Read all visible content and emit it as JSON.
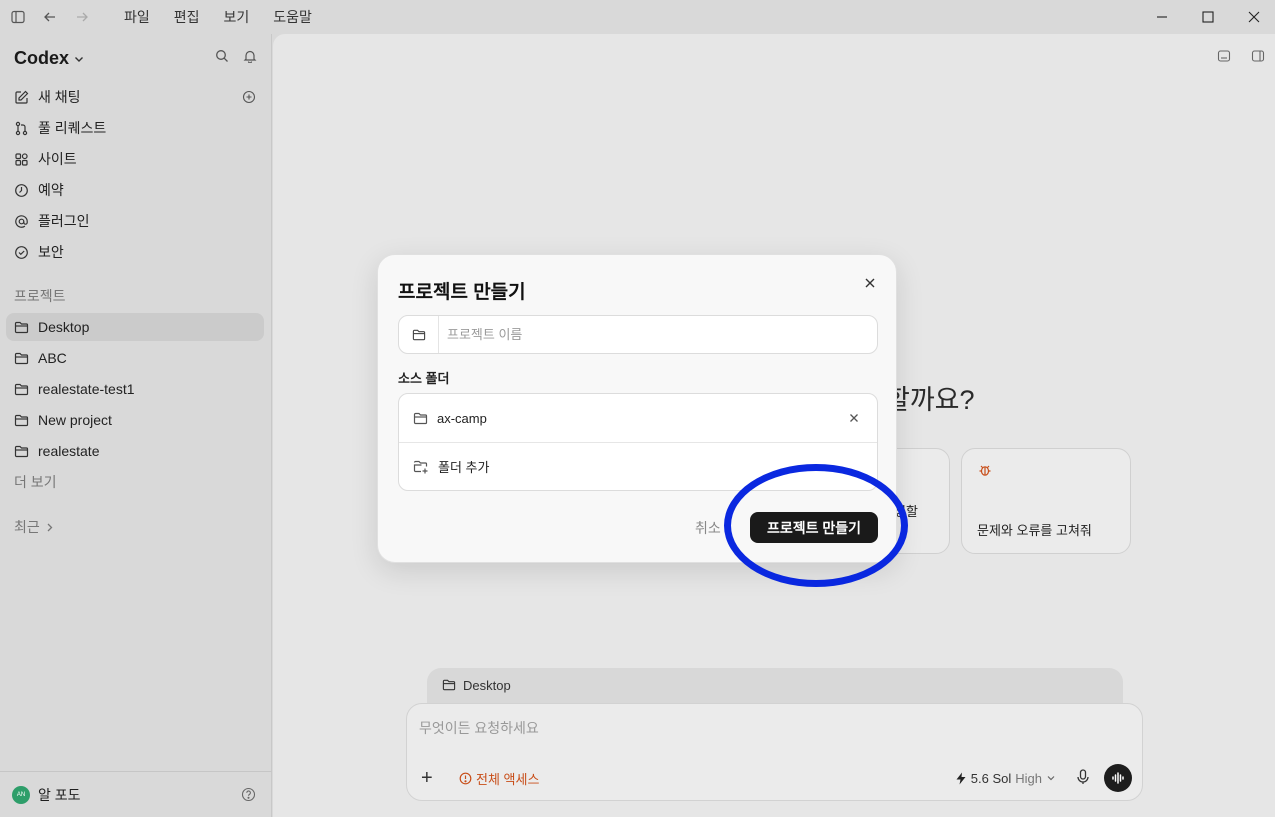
{
  "menu": [
    "파일",
    "편집",
    "보기",
    "도움말"
  ],
  "sidebar": {
    "brand": "Codex",
    "nav": [
      {
        "label": "새 채팅",
        "icon": "edit-icon"
      },
      {
        "label": "풀 리퀘스트",
        "icon": "pull-request-icon"
      },
      {
        "label": "사이트",
        "icon": "apps-icon"
      },
      {
        "label": "예약",
        "icon": "clock-icon"
      },
      {
        "label": "플러그인",
        "icon": "at-icon"
      },
      {
        "label": "보안",
        "icon": "shield-icon"
      }
    ],
    "projects_label": "프로젝트",
    "projects": [
      "Desktop",
      "ABC",
      "realestate-test1",
      "New project",
      "realestate"
    ],
    "more_label": "더 보기",
    "recent_label": "최근",
    "user": {
      "initials": "AN",
      "name": "알 포도"
    }
  },
  "main": {
    "heading_fragment": "할까요?",
    "card_partial_text": "정할",
    "card_text": "문제와 오류를 고쳐줘",
    "folder_chip": "Desktop",
    "composer": {
      "placeholder": "무엇이든 요청하세요",
      "access_label": "전체 액세스",
      "model": "5.6 Sol",
      "level": "High"
    }
  },
  "dialog": {
    "title": "프로젝트 만들기",
    "name_placeholder": "프로젝트 이름",
    "source_label": "소스 폴더",
    "source_folder": "ax-camp",
    "add_folder": "폴더 추가",
    "cancel": "취소",
    "create": "프로젝트 만들기"
  },
  "colors": {
    "accent_warning": "#c84d18",
    "highlight": "#0a28e0",
    "primary_button": "#1a1a1a"
  }
}
